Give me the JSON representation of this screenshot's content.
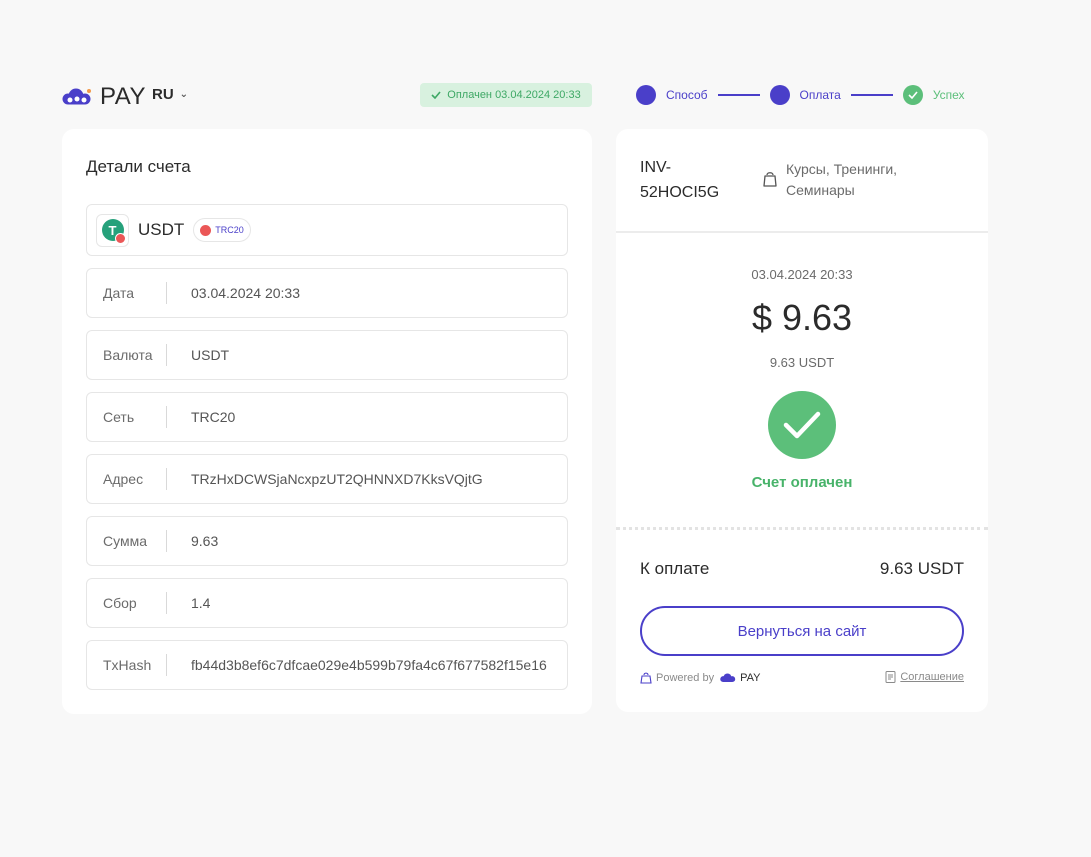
{
  "header": {
    "logo_text": "PAY",
    "language": "RU",
    "paid_badge": "Оплачен 03.04.2024 20:33",
    "steps": [
      {
        "label": "Способ",
        "state": "active"
      },
      {
        "label": "Оплата",
        "state": "active"
      },
      {
        "label": "Успех",
        "state": "done"
      }
    ]
  },
  "details": {
    "title": "Детали счета",
    "coin": {
      "name": "USDT",
      "icon_letter": "T",
      "network": "TRC20"
    },
    "rows": [
      {
        "label": "Дата",
        "value": "03.04.2024 20:33"
      },
      {
        "label": "Валюта",
        "value": "USDT"
      },
      {
        "label": "Сеть",
        "value": "TRC20"
      },
      {
        "label": "Адрес",
        "value": "TRzHxDCWSjaNcxpzUT2QHNNXD7KksVQjtG"
      },
      {
        "label": "Сумма",
        "value": "9.63"
      },
      {
        "label": "Сбор",
        "value": "1.4"
      },
      {
        "label": "TxHash",
        "value": "fb44d3b8ef6c7dfcae029e4b599b79fa4c67f677582f15e16"
      }
    ]
  },
  "invoice": {
    "id": "INV-52HOCI5G",
    "category": "Курсы, Тренинги, Семинары",
    "date": "03.04.2024 20:33",
    "amount": "$ 9.63",
    "amount_crypto": "9.63 USDT",
    "status": "Счет оплачен",
    "to_pay_label": "К оплате",
    "to_pay_value": "9.63 USDT",
    "back_button": "Вернуться на сайт",
    "powered_by": "Powered by",
    "powered_brand": "PAY",
    "agreement": "Соглашение"
  },
  "colors": {
    "accent": "#4a3fc9",
    "success": "#5cbf7a",
    "badge_bg": "#d8f1df"
  }
}
